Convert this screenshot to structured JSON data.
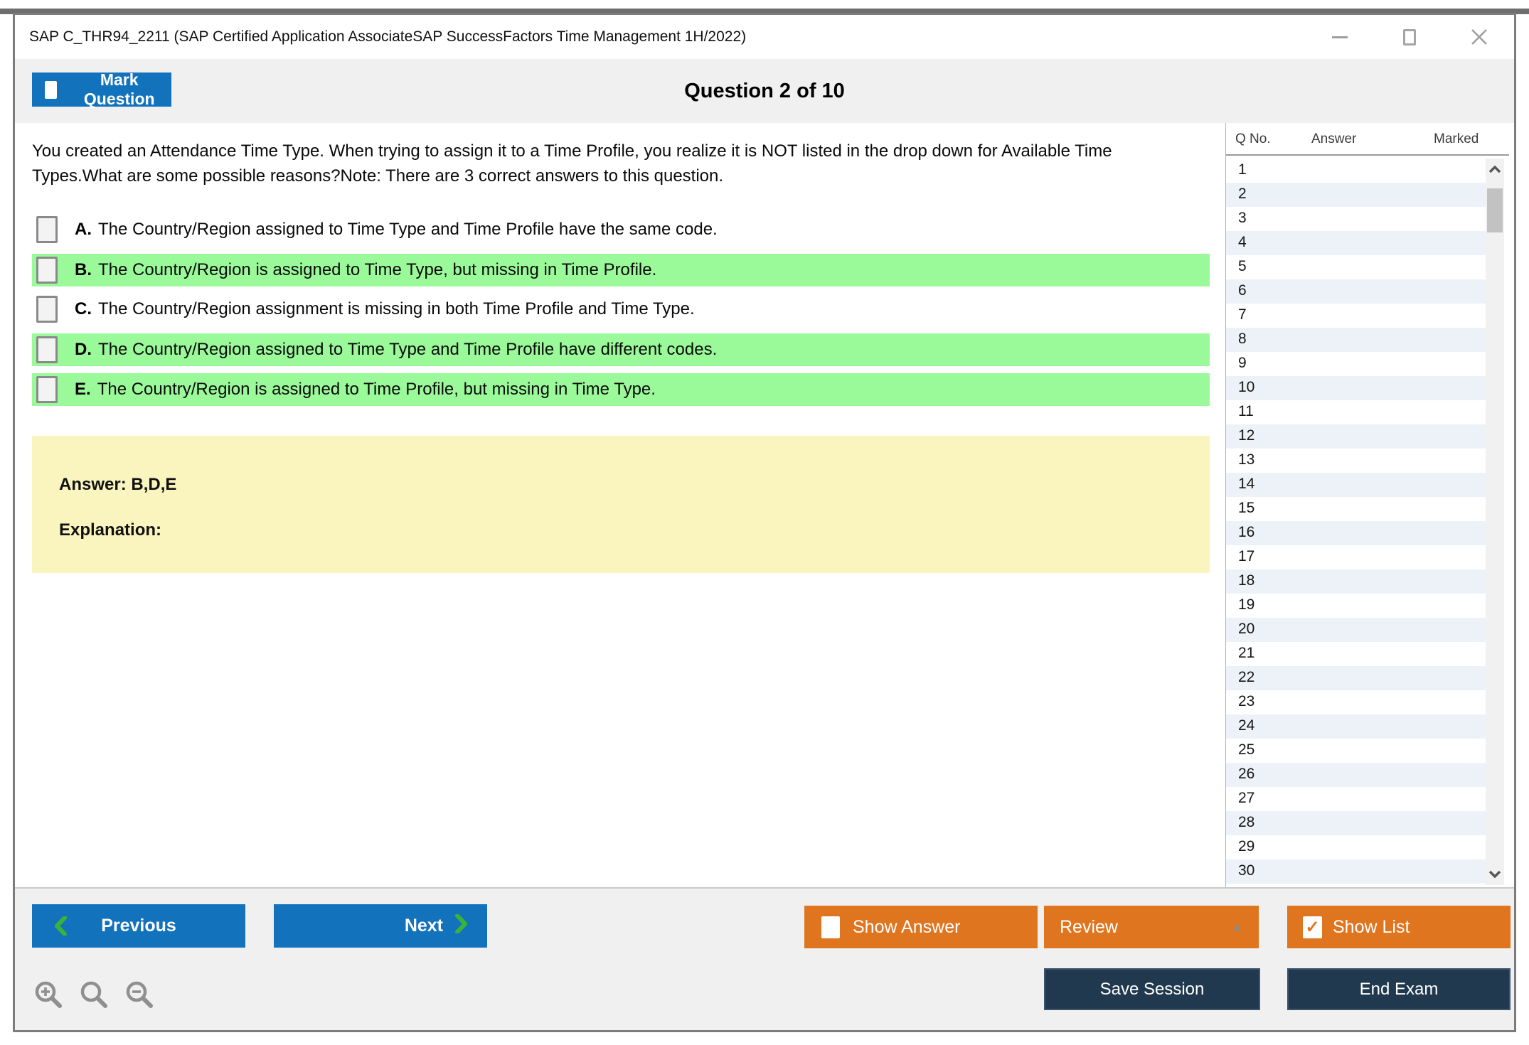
{
  "window": {
    "title": "SAP C_THR94_2211 (SAP Certified Application AssociateSAP SuccessFactors Time Management 1H/2022)"
  },
  "header": {
    "mark_question": "Mark Question",
    "question_counter": "Question 2 of 10"
  },
  "question": {
    "text": "You created an Attendance Time Type. When trying to assign it to a Time Profile, you realize it is NOT listed in the drop down for Available Time Types.What are some possible reasons?Note: There are 3 correct answers to this question.",
    "options": [
      {
        "letter": "A.",
        "text": "The Country/Region assigned to Time Type and Time Profile have the same code.",
        "highlighted": false
      },
      {
        "letter": "B.",
        "text": "The Country/Region is assigned to Time Type, but missing in Time Profile.",
        "highlighted": true
      },
      {
        "letter": "C.",
        "text": "The Country/Region assignment is missing in both Time Profile and Time Type.",
        "highlighted": false
      },
      {
        "letter": "D.",
        "text": "The Country/Region assigned to Time Type and Time Profile have different codes.",
        "highlighted": true
      },
      {
        "letter": "E.",
        "text": "The Country/Region is assigned to Time Profile, but missing in Time Type.",
        "highlighted": true
      }
    ],
    "answer": "Answer: B,D,E",
    "explanation": "Explanation:"
  },
  "sidebar": {
    "columns": [
      "Q No.",
      "Answer",
      "Marked"
    ],
    "question_numbers": [
      "1",
      "2",
      "3",
      "4",
      "5",
      "6",
      "7",
      "8",
      "9",
      "10",
      "11",
      "12",
      "13",
      "14",
      "15",
      "16",
      "17",
      "18",
      "19",
      "20",
      "21",
      "22",
      "23",
      "24",
      "25",
      "26",
      "27",
      "28",
      "29",
      "30"
    ]
  },
  "footer": {
    "previous": "Previous",
    "next": "Next",
    "show_answer": "Show Answer",
    "review": "Review",
    "show_list": "Show List",
    "save_session": "Save Session",
    "end_exam": "End Exam"
  },
  "icons": {
    "check": "✓",
    "review_caret": "▲"
  },
  "colors": {
    "accent_blue": "#1272bc",
    "accent_orange": "#e0751f",
    "dark_navy": "#21394e",
    "correct_green": "#9afa9a",
    "answer_yellow": "#faf5be",
    "chevron_green": "#3bb33b"
  }
}
